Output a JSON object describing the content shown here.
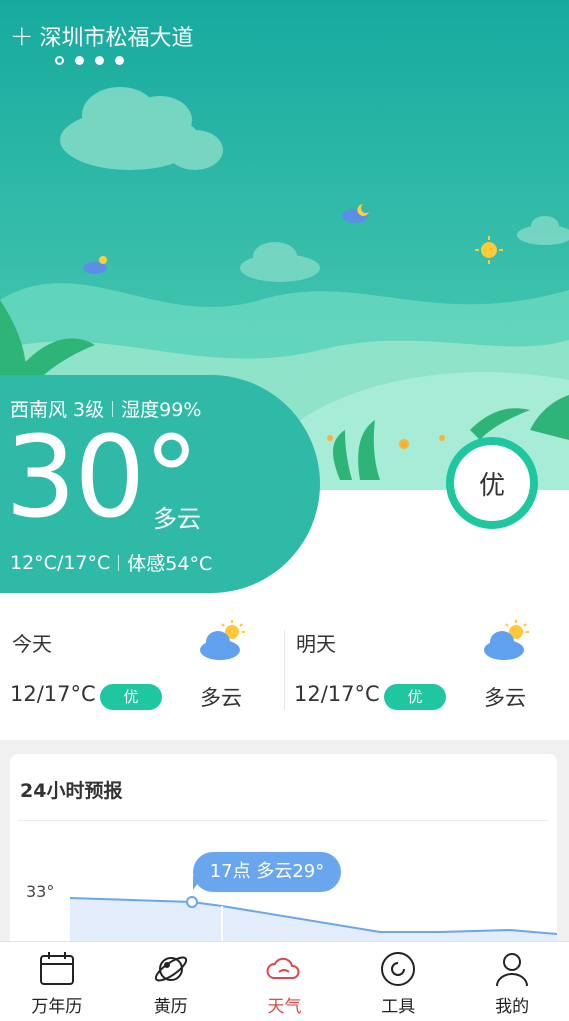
{
  "header": {
    "location": "深圳市松福大道",
    "page_count": 4,
    "active_page": 0
  },
  "current": {
    "wind": "西南风 3级",
    "humidity": "湿度99%",
    "temperature": "30°",
    "condition": "多云",
    "range": "12°C/17°C",
    "feels_like": "体感54°C",
    "aqi": "优"
  },
  "forecast": [
    {
      "name": "今天",
      "temp": "12/17°C",
      "aqi": "优",
      "condition": "多云",
      "icon": "partly-cloudy-icon"
    },
    {
      "name": "明天",
      "temp": "12/17°C",
      "aqi": "优",
      "condition": "多云",
      "icon": "partly-cloudy-icon"
    }
  ],
  "hourly": {
    "title": "24小时预报",
    "tooltip": "17点 多云29°",
    "ytick": "33°"
  },
  "tabs": [
    {
      "label": "万年历",
      "icon": "calendar-icon"
    },
    {
      "label": "黄历",
      "icon": "planet-icon"
    },
    {
      "label": "天气",
      "icon": "cloud-icon",
      "active": true
    },
    {
      "label": "工具",
      "icon": "tools-icon"
    },
    {
      "label": "我的",
      "icon": "user-icon"
    }
  ],
  "colors": {
    "accent": "#2fbaa8",
    "aqi_green": "#1ec7a0",
    "tab_active": "#e0474c",
    "tooltip": "#6aa6ee"
  }
}
